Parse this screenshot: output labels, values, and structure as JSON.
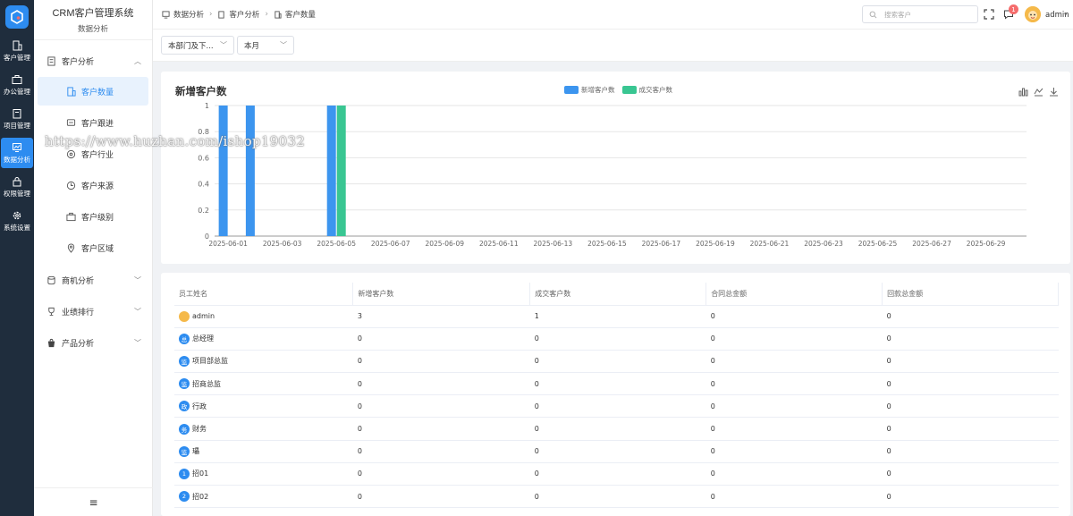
{
  "app": {
    "title": "CRM客户管理系统",
    "section": "数据分析",
    "colors": {
      "accent": "#2d8cf0",
      "series_new": "#3c95ef",
      "series_deal": "#39c692",
      "rail_bg": "#1f2d3d"
    }
  },
  "rail": [
    {
      "label": "客户管理",
      "icon": "building-icon"
    },
    {
      "label": "办公管理",
      "icon": "briefcase-icon"
    },
    {
      "label": "项目管理",
      "icon": "clipboard-icon"
    },
    {
      "label": "数据分析",
      "icon": "chart-icon"
    },
    {
      "label": "权限管理",
      "icon": "lock-icon"
    },
    {
      "label": "系统设置",
      "icon": "gear-icon"
    }
  ],
  "submenu": {
    "group_customer": "客户分析",
    "items": [
      "客户数量",
      "客户跟进",
      "客户行业",
      "客户来源",
      "客户级别",
      "客户区域"
    ],
    "group_opportunity": "商机分析",
    "group_performance": "业绩排行",
    "group_product": "产品分析"
  },
  "breadcrumb": [
    "数据分析",
    "客户分析",
    "客户数量"
  ],
  "header": {
    "search_placeholder": "搜索客户",
    "notification_count": "1",
    "user": "admin"
  },
  "filters": {
    "department": "本部门及下...",
    "period": "本月"
  },
  "chart": {
    "title": "新增客户数",
    "legend": [
      "新增客户数",
      "成交客户数"
    ]
  },
  "chart_data": {
    "type": "bar",
    "title": "新增客户数",
    "categories": [
      "2025-06-01",
      "2025-06-02",
      "2025-06-03",
      "2025-06-04",
      "2025-06-05",
      "2025-06-06",
      "2025-06-07",
      "2025-06-08",
      "2025-06-09",
      "2025-06-10",
      "2025-06-11",
      "2025-06-12",
      "2025-06-13",
      "2025-06-14",
      "2025-06-15",
      "2025-06-16",
      "2025-06-17",
      "2025-06-18",
      "2025-06-19",
      "2025-06-20",
      "2025-06-21",
      "2025-06-22",
      "2025-06-23",
      "2025-06-24",
      "2025-06-25",
      "2025-06-26",
      "2025-06-27",
      "2025-06-28",
      "2025-06-29",
      "2025-06-30"
    ],
    "x_tick_labels": [
      "2025-06-01",
      "2025-06-03",
      "2025-06-05",
      "2025-06-07",
      "2025-06-09",
      "2025-06-11",
      "2025-06-13",
      "2025-06-15",
      "2025-06-17",
      "2025-06-19",
      "2025-06-21",
      "2025-06-23",
      "2025-06-25",
      "2025-06-27",
      "2025-06-29"
    ],
    "series": [
      {
        "name": "新增客户数",
        "color": "#3c95ef",
        "values": [
          1,
          1,
          0,
          0,
          1,
          0,
          0,
          0,
          0,
          0,
          0,
          0,
          0,
          0,
          0,
          0,
          0,
          0,
          0,
          0,
          0,
          0,
          0,
          0,
          0,
          0,
          0,
          0,
          0,
          0
        ]
      },
      {
        "name": "成交客户数",
        "color": "#39c692",
        "values": [
          0,
          0,
          0,
          0,
          1,
          0,
          0,
          0,
          0,
          0,
          0,
          0,
          0,
          0,
          0,
          0,
          0,
          0,
          0,
          0,
          0,
          0,
          0,
          0,
          0,
          0,
          0,
          0,
          0,
          0
        ]
      }
    ],
    "ylim": [
      0,
      1
    ],
    "y_ticks": [
      "0",
      "0.2",
      "0.4",
      "0.6",
      "0.8",
      "1"
    ],
    "grid": true,
    "legend_position": "top-center"
  },
  "table": {
    "headers": [
      "员工姓名",
      "新增客户数",
      "成交客户数",
      "合同总金额",
      "回款总金额"
    ],
    "rows": [
      {
        "name": "admin",
        "avatar_text": "",
        "avatar_color": "#f5b94a",
        "cells": [
          "3",
          "1",
          "0",
          "0"
        ]
      },
      {
        "name": "总经理",
        "avatar_text": "总",
        "avatar_color": "#2d8cf0",
        "cells": [
          "0",
          "0",
          "0",
          "0"
        ]
      },
      {
        "name": "项目部总监",
        "avatar_text": "监",
        "avatar_color": "#2d8cf0",
        "cells": [
          "0",
          "0",
          "0",
          "0"
        ]
      },
      {
        "name": "招商总监",
        "avatar_text": "监",
        "avatar_color": "#2d8cf0",
        "cells": [
          "0",
          "0",
          "0",
          "0"
        ]
      },
      {
        "name": "行政",
        "avatar_text": "政",
        "avatar_color": "#2d8cf0",
        "cells": [
          "0",
          "0",
          "0",
          "0"
        ]
      },
      {
        "name": "财务",
        "avatar_text": "务",
        "avatar_color": "#2d8cf0",
        "cells": [
          "0",
          "0",
          "0",
          "0"
        ]
      },
      {
        "name": "瓃",
        "avatar_text": "监",
        "avatar_color": "#2d8cf0",
        "cells": [
          "0",
          "0",
          "0",
          "0"
        ]
      },
      {
        "name": "招01",
        "avatar_text": "1",
        "avatar_color": "#2d8cf0",
        "cells": [
          "0",
          "0",
          "0",
          "0"
        ]
      },
      {
        "name": "招02",
        "avatar_text": "2",
        "avatar_color": "#2d8cf0",
        "cells": [
          "0",
          "0",
          "0",
          "0"
        ]
      }
    ]
  },
  "watermark": "https://www.huzhan.com/ishop19032"
}
